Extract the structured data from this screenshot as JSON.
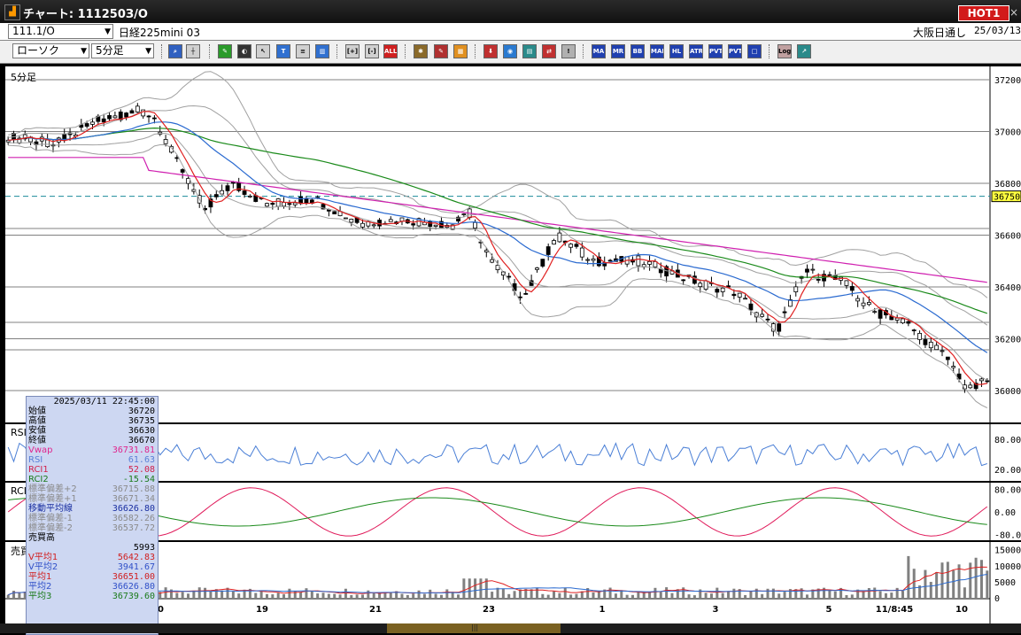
{
  "window": {
    "title": "チャート: 111250З/O",
    "hot_badge": "HOT1",
    "close": "×"
  },
  "symbol_bar": {
    "symbol_code": "111.1/O",
    "contract": "日経225mini 03",
    "exchange": "大阪日通し",
    "date": "25/03/13"
  },
  "toolbar": {
    "chart_type": "ローソク",
    "period": "5分足",
    "buttons": [
      "search-icon",
      "crosshair-icon",
      "pen-icon",
      "magnet-icon",
      "cursor-icon",
      "text-icon",
      "list-icon",
      "trash-icon",
      "zoom-in-icon",
      "zoom-out-icon",
      "all-button",
      "settings-icon",
      "wrench-icon",
      "color-icon",
      "download-icon",
      "alarm-icon",
      "indicator-icon",
      "compare-icon",
      "blank-icon",
      "ma-button",
      "mr-button",
      "bb-button",
      "mae-button",
      "hl-button",
      "atr-button",
      "pvt-button",
      "pvt2-button",
      "box-button",
      "log-button",
      "export-icon"
    ],
    "all_label": "ALL",
    "ind_labels": {
      "ma": "MA",
      "mr": "MR",
      "bb": "BB",
      "mae": "MAE",
      "hl": "HL",
      "atr": "ATR",
      "pvt": "PVT",
      "log": "Log"
    }
  },
  "chart": {
    "period_label": "5分足",
    "current_price_label": "36750",
    "price_axis": [
      "37200",
      "37000",
      "36800",
      "36600",
      "36400",
      "36200",
      "36000"
    ],
    "rsi_label": "RSI",
    "rsi_axis": [
      "80.00",
      "20.00"
    ],
    "rci_label": "RCI",
    "rci_axis": [
      "80.00",
      "0.00",
      "-80.0"
    ],
    "vol_label": "売買高",
    "vol_axis": [
      "15000",
      "10000",
      "5000",
      "0"
    ],
    "x_axis": [
      "00",
      "19",
      "21",
      "23",
      "1",
      "3",
      "5",
      "11/8:45",
      "10"
    ]
  },
  "infobox": {
    "datetime": "2025/03/11 22:45:00",
    "rows": [
      {
        "label": "始値",
        "value": "36720",
        "color": "#000000"
      },
      {
        "label": "高値",
        "value": "36735",
        "color": "#000000"
      },
      {
        "label": "安値",
        "value": "36630",
        "color": "#000000"
      },
      {
        "label": "終値",
        "value": "36670",
        "color": "#000000"
      },
      {
        "label": "Vwap",
        "value": "36731.81",
        "color": "#e0248c"
      },
      {
        "label": "RSI",
        "value": "61.63",
        "color": "#5a7fd6"
      },
      {
        "label": "RCI1",
        "value": "52.08",
        "color": "#d11f4a"
      },
      {
        "label": "RCI2",
        "value": "-15.54",
        "color": "#1a7a1a"
      },
      {
        "label": "標準偏差+2",
        "value": "36715.88",
        "color": "#8a8a8a"
      },
      {
        "label": "標準偏差+1",
        "value": "36671.34",
        "color": "#8a8a8a"
      },
      {
        "label": "移動平均線",
        "value": "36626.80",
        "color": "#1a2fa0"
      },
      {
        "label": "標準偏差-1",
        "value": "36582.26",
        "color": "#8a8a8a"
      },
      {
        "label": "標準偏差-2",
        "value": "36537.72",
        "color": "#8a8a8a"
      },
      {
        "label": "売買高",
        "value": "",
        "color": "#000000"
      },
      {
        "label": "",
        "value": "5993",
        "color": "#000000"
      },
      {
        "label": "V平均1",
        "value": "5642.83",
        "color": "#d11f1f"
      },
      {
        "label": "V平均2",
        "value": "3941.67",
        "color": "#3050c8"
      },
      {
        "label": "平均1",
        "value": "36651.00",
        "color": "#d11f1f"
      },
      {
        "label": "平均2",
        "value": "36626.80",
        "color": "#3050c8"
      },
      {
        "label": "平均3",
        "value": "36739.60",
        "color": "#1a7a1a"
      }
    ]
  },
  "colors": {
    "ma_short": "#e02020",
    "ma_mid": "#2a6ad0",
    "ma_long": "#1a8a1a",
    "vwap": "#d020b0",
    "bands": "#a0a0a0",
    "rsi": "#4a7fd6",
    "rci1": "#e01a5a",
    "rci2": "#1a8a1a",
    "volume": "#808080",
    "current": "#1a8a9a"
  }
}
